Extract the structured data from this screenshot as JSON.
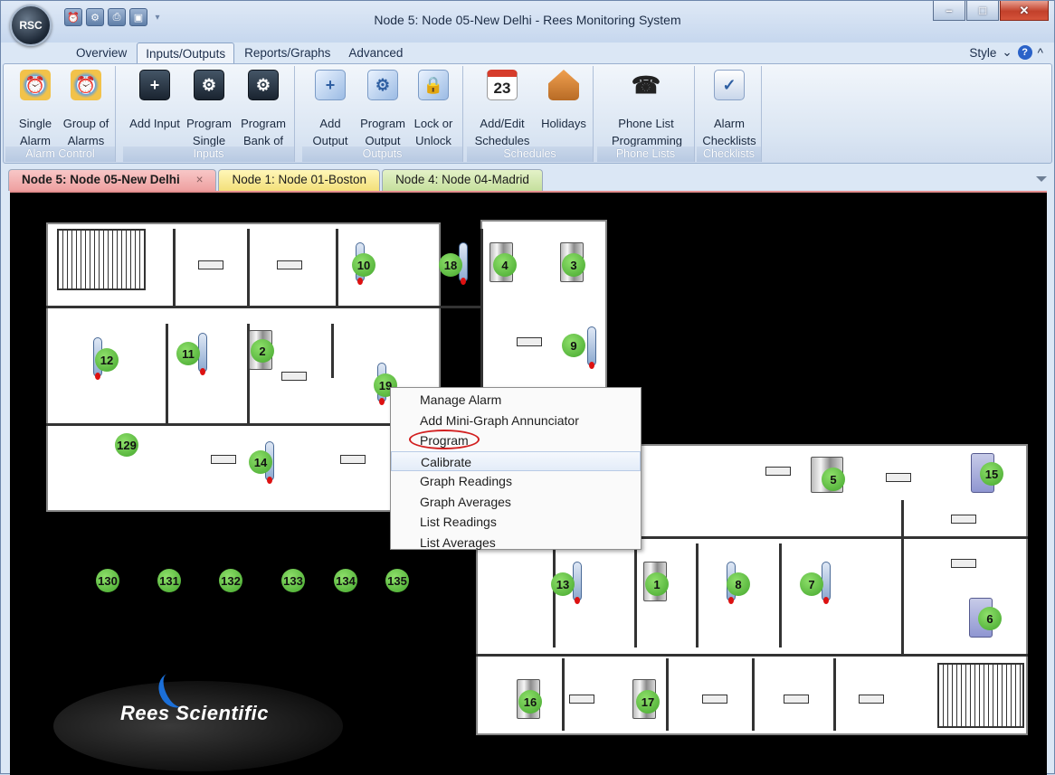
{
  "window": {
    "title": "Node 5: Node 05-New Delhi - Rees Monitoring System",
    "app_badge": "RSC"
  },
  "quick_access": [
    "alarm-clock-icon",
    "settings-icon",
    "print-icon",
    "save-icon"
  ],
  "window_controls": {
    "minimize": "–",
    "maximize": "□",
    "close": "✕"
  },
  "ribbon_tabs": [
    {
      "label": "Overview",
      "active": false
    },
    {
      "label": "Inputs/Outputs",
      "active": true
    },
    {
      "label": "Reports/Graphs",
      "active": false
    },
    {
      "label": "Advanced",
      "active": false
    }
  ],
  "style_menu": {
    "label": "Style",
    "help": "?"
  },
  "ribbon_groups": [
    {
      "caption": "Alarm Control",
      "buttons": [
        {
          "label": "Single Alarm",
          "icon": "alarm-clock-icon",
          "glyph": "⏰"
        },
        {
          "label": "Group of Alarms",
          "icon": "alarm-group-icon",
          "glyph": "⏰"
        }
      ]
    },
    {
      "caption": "Inputs",
      "buttons": [
        {
          "label": "Add Input",
          "icon": "add-input-icon",
          "glyph": "+"
        },
        {
          "label": "Program Single",
          "icon": "program-single-icon",
          "glyph": "⚙"
        },
        {
          "label": "Program Bank of",
          "icon": "program-bank-icon",
          "glyph": "⚙"
        }
      ]
    },
    {
      "caption": "Outputs",
      "buttons": [
        {
          "label": "Add Output",
          "icon": "add-output-icon",
          "glyph": "+"
        },
        {
          "label": "Program Output",
          "icon": "program-output-icon",
          "glyph": "⚙"
        },
        {
          "label": "Lock or Unlock",
          "icon": "lock-icon",
          "glyph": "🔒"
        }
      ]
    },
    {
      "caption": "Schedules",
      "buttons": [
        {
          "label": "Add/Edit Schedules",
          "icon": "calendar-icon",
          "glyph": "23"
        },
        {
          "label": "Holidays",
          "icon": "house-icon",
          "glyph": ""
        }
      ]
    },
    {
      "caption": "Phone Lists",
      "buttons": [
        {
          "label": "Phone List Programming",
          "icon": "phone-icon",
          "glyph": "☎"
        }
      ]
    },
    {
      "caption": "Checklists",
      "buttons": [
        {
          "label": "Alarm Checklists",
          "icon": "checklist-icon",
          "glyph": "✓"
        }
      ]
    }
  ],
  "doc_tabs": [
    {
      "label": "Node 5: Node 05-New Delhi",
      "close": "×",
      "active": true,
      "color": "#f2b3b3"
    },
    {
      "label": "Node 1: Node 01-Boston",
      "active": false,
      "color": "#f7e795"
    },
    {
      "label": "Node 4: Node 04-Madrid",
      "active": false,
      "color": "#d3e8ae"
    }
  ],
  "sensors": [
    {
      "num": "10",
      "kind": "thermo"
    },
    {
      "num": "18",
      "kind": "thermo"
    },
    {
      "num": "4",
      "kind": "fridge"
    },
    {
      "num": "3",
      "kind": "fridge"
    },
    {
      "num": "9",
      "kind": "thermo"
    },
    {
      "num": "12",
      "kind": "thermo"
    },
    {
      "num": "11",
      "kind": "thermo"
    },
    {
      "num": "2",
      "kind": "fridge"
    },
    {
      "num": "19",
      "kind": "thermo"
    },
    {
      "num": "129",
      "kind": "none"
    },
    {
      "num": "14",
      "kind": "thermo"
    },
    {
      "num": "5",
      "kind": "fridge"
    },
    {
      "num": "15",
      "kind": "cabinet"
    },
    {
      "num": "13",
      "kind": "thermo"
    },
    {
      "num": "1",
      "kind": "fridge"
    },
    {
      "num": "8",
      "kind": "thermo"
    },
    {
      "num": "7",
      "kind": "thermo"
    },
    {
      "num": "6",
      "kind": "cabinet"
    },
    {
      "num": "16",
      "kind": "fridge"
    },
    {
      "num": "17",
      "kind": "fridge"
    },
    {
      "num": "130",
      "kind": "none"
    },
    {
      "num": "131",
      "kind": "none"
    },
    {
      "num": "132",
      "kind": "none"
    },
    {
      "num": "133",
      "kind": "none"
    },
    {
      "num": "134",
      "kind": "none"
    },
    {
      "num": "135",
      "kind": "none"
    }
  ],
  "context_menu": {
    "items": [
      {
        "label": "Manage Alarm"
      },
      {
        "label": "Add Mini-Graph Annunciator"
      },
      {
        "label": "Program",
        "circled": true
      },
      {
        "label": "Calibrate",
        "highlighted": true
      },
      {
        "label": "Graph Readings"
      },
      {
        "label": "Graph Averages"
      },
      {
        "label": "List Readings"
      },
      {
        "label": "List Averages"
      }
    ]
  },
  "logo": {
    "text": "Rees Scientific"
  },
  "colors": {
    "badge": "#5cc13d",
    "highlight_ring": "#d21f1f",
    "tab_active": "#f2b3b3"
  }
}
